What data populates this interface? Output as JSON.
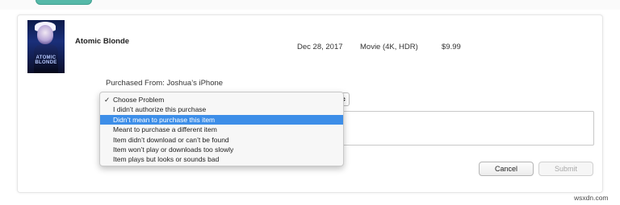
{
  "item": {
    "title": "Atomic Blonde",
    "date": "Dec 28, 2017",
    "type": "Movie (4K, HDR)",
    "price": "$9.99",
    "poster_text": "ATOMIC BLONDE"
  },
  "report": {
    "purchased_from": "Purchased From: Joshua’s iPhone",
    "problem_menu": {
      "items": [
        {
          "label": "Choose Problem",
          "checked": true
        },
        {
          "label": "I didn’t authorize this purchase"
        },
        {
          "label": "Didn’t mean to purchase this item",
          "highlighted": true
        },
        {
          "label": "Meant to purchase a different item"
        },
        {
          "label": "Item didn’t download or can’t be found"
        },
        {
          "label": "Item won’t play or downloads too slowly"
        },
        {
          "label": "Item plays but looks or sounds bad"
        }
      ],
      "check_glyph": "✓"
    },
    "cancel_label": "Cancel",
    "submit_label": "Submit"
  },
  "watermark": "wsxdn.com",
  "colors": {
    "highlight": "#3d8ee8",
    "top_button": "#55b8a8"
  }
}
